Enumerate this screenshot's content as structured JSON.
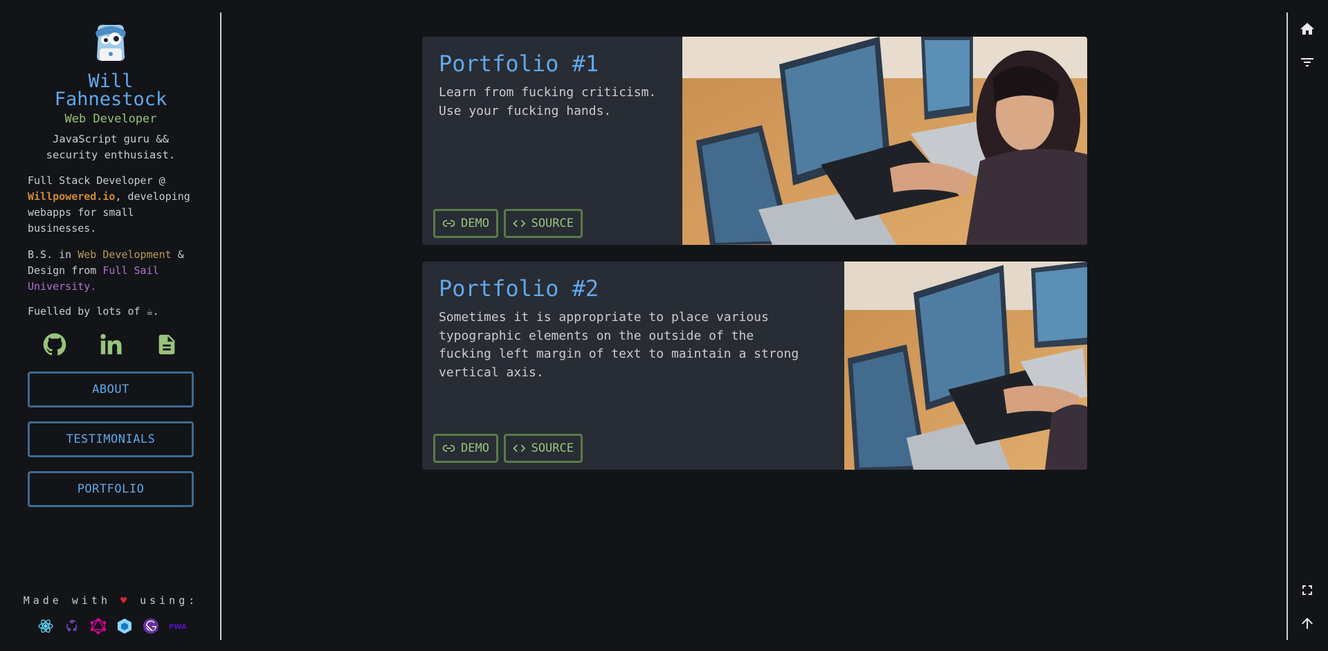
{
  "profile": {
    "name_line1": "Will",
    "name_line2": "Fahnestock",
    "role": "Web Developer",
    "tagline": "JavaScript guru && security enthusiast.",
    "bio1_prefix": "Full Stack Developer @ ",
    "bio1_link": "Willpowered.io",
    "bio1_suffix": ", developing webapps for small businesses.",
    "bio2_prefix": "B.S. in ",
    "bio2_link1": "Web Development",
    "bio2_mid": " & Design from ",
    "bio2_link2": "Full Sail University.",
    "bio3": "Fuelled by lots of ☕."
  },
  "socials": [
    "github-icon",
    "linkedin-icon",
    "resume-icon"
  ],
  "nav": {
    "about": "ABOUT",
    "testimonials": "TESTIMONIALS",
    "portfolio": "PORTFOLIO"
  },
  "footer": {
    "made_prefix": "Made with ",
    "heart": "♥",
    "made_suffix": " using:",
    "tech": [
      "react-icon",
      "redux-icon",
      "graphql-icon",
      "webpack-icon",
      "gatsby-icon",
      "pwa-icon"
    ],
    "pwa_label": "PWA"
  },
  "projects": [
    {
      "title": "Portfolio #1",
      "description": "Learn from fucking criticism. Use your fucking hands.",
      "demo_label": "DEMO",
      "source_label": "SOURCE"
    },
    {
      "title": "Portfolio #2",
      "description": "Sometimes it is appropriate to place various typographic elements on the outside of the fucking left margin of text to maintain a strong vertical axis.",
      "demo_label": "DEMO",
      "source_label": "SOURCE"
    }
  ],
  "rail": [
    "home-icon",
    "filter-icon",
    "fullscreen-icon",
    "arrow-up-icon"
  ],
  "colors": {
    "background": "#121418",
    "card": "#282c34",
    "accent_blue": "#61a8ea",
    "accent_green": "#98c379"
  }
}
